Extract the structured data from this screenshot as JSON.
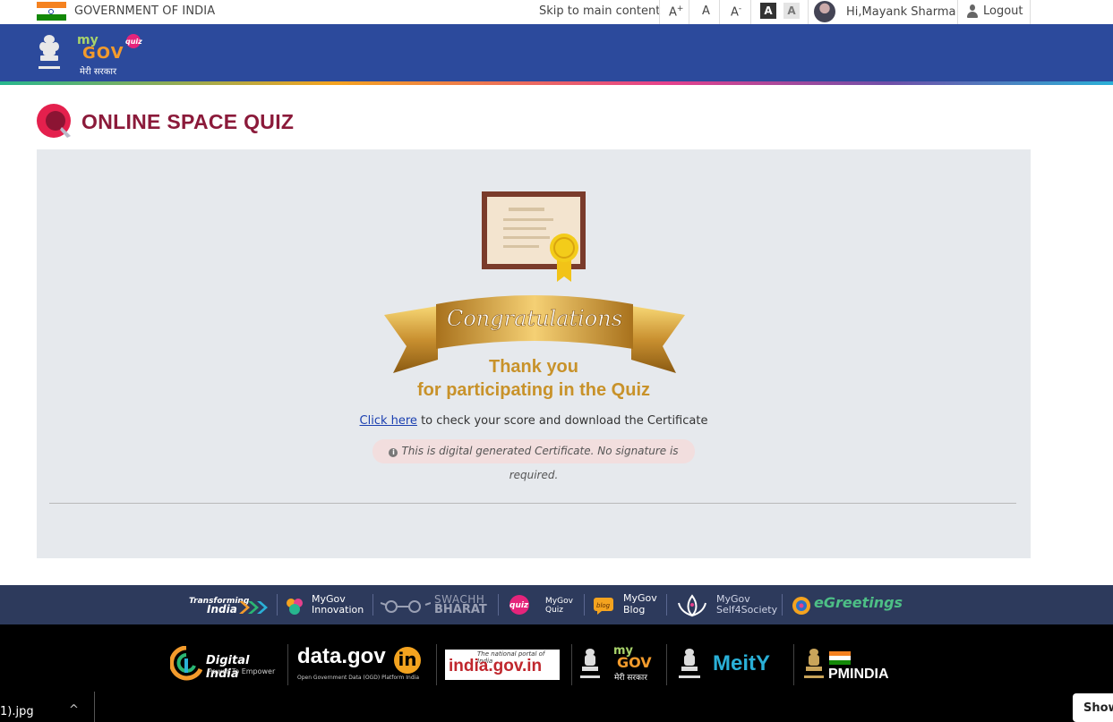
{
  "topbar": {
    "gov_label": "GOVERNMENT OF INDIA",
    "skip_label": "Skip to main content",
    "font_increase": "A",
    "font_increase_sup": "+",
    "font_normal": "A",
    "font_decrease": "A",
    "font_decrease_sup": "-",
    "contrast_dark": "A",
    "contrast_light": "A",
    "greeting": "Hi,Mayank Sharma",
    "logout_label": "Logout"
  },
  "header": {
    "logo_my": "my",
    "logo_gov": "GOV",
    "logo_quiz": "quiz",
    "logo_hindi": "मेरी सरकार"
  },
  "page": {
    "title": "ONLINE SPACE QUIZ"
  },
  "result": {
    "congrats": "Congratulations",
    "thank_line1": "Thank you",
    "thank_line2": "for participating in the Quiz",
    "link_label": "Click here",
    "link_suffix": " to check your score and download the Certificate",
    "note": "This is digital generated Certificate. No signature is required."
  },
  "footer_links": {
    "transforming_line1": "Transforming",
    "transforming_line2": "India",
    "innovation_line1": "MyGov",
    "innovation_line2": "Innovation",
    "swachh_line1": "SWACHH",
    "swachh_line2": "BHARAT",
    "quiz_badge": "quiz",
    "quiz_line1": "MyGov",
    "quiz_line2": "Quiz",
    "blog_badge": "blog",
    "blog_line1": "MyGov",
    "blog_line2": "Blog",
    "self_line1": "MyGov",
    "self_line2": "Self4Society",
    "egreetings": "eGreetings"
  },
  "footer_partners": {
    "digital_india": "Digital India",
    "digital_india_tag": "Power To Empower",
    "datagov": "data.gov",
    "datagov_in": "in",
    "datagov_tag": "Open Government Data (OGD) Platform India",
    "indiagov_tag": "The national portal of India",
    "indiagov": "india.gov.in",
    "mygov_my": "my",
    "mygov_gov": "GOV",
    "mygov_hindi": "मेरी सरकार",
    "meity": "MeitY",
    "pmindia": "PMINDIA"
  },
  "download_bar": {
    "filename": "1).jpg",
    "chevron": "^",
    "show_label": "Show"
  },
  "colors": {
    "header_blue": "#2c4a9c",
    "title_maroon": "#8b1a3a",
    "gold": "#c8922a",
    "footer1": "#2d3a5c",
    "footer2": "#000000"
  }
}
